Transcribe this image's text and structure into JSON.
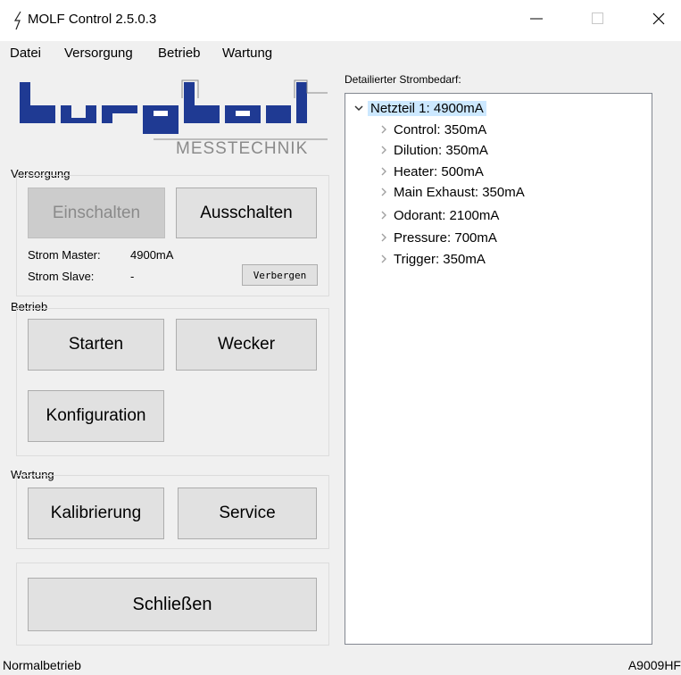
{
  "window": {
    "title": "MOLF Control 2.5.0.3",
    "app_icon": "lightning-icon",
    "controls": {
      "minimize": "minimize-icon",
      "maximize": "maximize-icon",
      "close": "close-icon"
    }
  },
  "menu": [
    "Datei",
    "Versorgung",
    "Betrieb",
    "Wartung"
  ],
  "logo": {
    "brand": "burghardt",
    "subtitle": "MESSTECHNIK",
    "colors": {
      "blue": "#1f3a93",
      "gray": "#8a8a8a"
    }
  },
  "versorgung": {
    "label": "Versorgung",
    "on_button": "Einschalten",
    "on_disabled": true,
    "off_button": "Ausschalten",
    "strom_master_label": "Strom Master:",
    "strom_master_value": "4900mA",
    "strom_slave_label": "Strom Slave:",
    "strom_slave_value": "-",
    "hide_button": "Verbergen"
  },
  "betrieb": {
    "label": "Betrieb",
    "start_button": "Starten",
    "alarm_button": "Wecker",
    "config_button": "Konfiguration"
  },
  "wartung": {
    "label": "Wartung",
    "calibration_button": "Kalibrierung",
    "service_button": "Service"
  },
  "close_button": "Schließen",
  "detail": {
    "label": "Detailierter Strombedarf:",
    "root": "Netzteil 1: 4900mA",
    "children": [
      "Control: 350mA",
      "Dilution: 350mA",
      "Heater: 500mA",
      "Main Exhaust: 350mA",
      "Odorant: 2100mA",
      "Pressure: 700mA",
      "Trigger: 350mA"
    ]
  },
  "status": {
    "mode": "Normalbetrieb",
    "device": "A9009HF"
  }
}
